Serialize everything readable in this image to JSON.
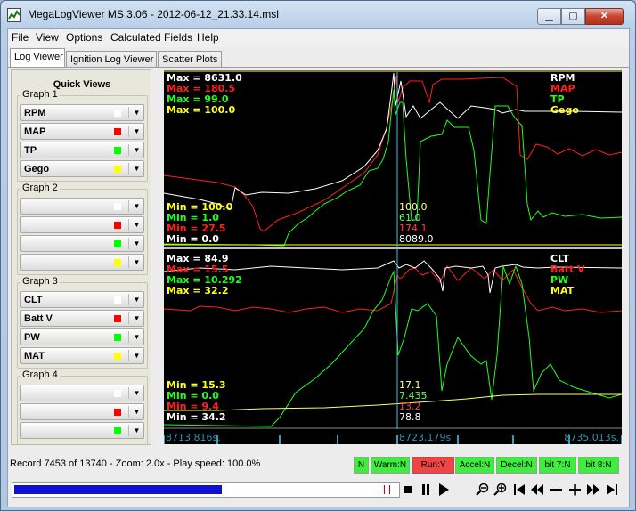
{
  "window": {
    "title": "MegaLogViewer MS 3.06 - 2012-06-12_21.33.14.msl"
  },
  "menu": [
    "File",
    "View",
    "Options",
    "Calculated Fields",
    "Help"
  ],
  "tabs": [
    "Log Viewer",
    "Ignition Log Viewer",
    "Scatter Plots"
  ],
  "quick_views": {
    "title": "Quick Views",
    "graphs": [
      {
        "label": "Graph 1",
        "fields": [
          {
            "name": "RPM",
            "color": "#ffffff"
          },
          {
            "name": "MAP",
            "color": "#ff0000"
          },
          {
            "name": "TP",
            "color": "#00ff00"
          },
          {
            "name": "Gego",
            "color": "#ffff00"
          }
        ]
      },
      {
        "label": "Graph 2",
        "fields": [
          {
            "name": "",
            "color": "#ffffff"
          },
          {
            "name": "",
            "color": "#ff0000"
          },
          {
            "name": "",
            "color": "#00ff00"
          },
          {
            "name": "",
            "color": "#ffff00"
          }
        ]
      },
      {
        "label": "Graph 3",
        "fields": [
          {
            "name": "CLT",
            "color": "#ffffff"
          },
          {
            "name": "Batt V",
            "color": "#ff0000"
          },
          {
            "name": "PW",
            "color": "#00ff00"
          },
          {
            "name": "MAT",
            "color": "#ffff00"
          }
        ]
      },
      {
        "label": "Graph 4",
        "fields": [
          {
            "name": "",
            "color": "#ffffff"
          },
          {
            "name": "",
            "color": "#ff0000"
          },
          {
            "name": "",
            "color": "#00ff00"
          }
        ]
      }
    ]
  },
  "graph_panels": [
    {
      "names": [
        {
          "text": "RPM",
          "color": "#ffffff"
        },
        {
          "text": "MAP",
          "color": "#ff2020"
        },
        {
          "text": "TP",
          "color": "#20ff20"
        },
        {
          "text": "Gego",
          "color": "#ffff20"
        }
      ],
      "max_labels": [
        {
          "text": "Max = 8631.0",
          "color": "#ffffff"
        },
        {
          "text": "Max = 180.5",
          "color": "#ff2020"
        },
        {
          "text": "Max = 99.0",
          "color": "#20ff20"
        },
        {
          "text": "Max = 100.0",
          "color": "#ffff20"
        }
      ],
      "min_labels": [
        {
          "text": "Min = 100.0",
          "color": "#ffff20"
        },
        {
          "text": "Min = 1.0",
          "color": "#20ff20"
        },
        {
          "text": "Min = 27.5",
          "color": "#ff2020"
        },
        {
          "text": "Min = 0.0",
          "color": "#ffffff"
        }
      ],
      "cursor_values": [
        {
          "text": "100.0",
          "color": "#ffff80"
        },
        {
          "text": "61.0",
          "color": "#60ff60"
        },
        {
          "text": "174.1",
          "color": "#ff4040"
        },
        {
          "text": "8089.0",
          "color": "#ffffff"
        }
      ]
    },
    {
      "names": [
        {
          "text": "CLT",
          "color": "#ffffff"
        },
        {
          "text": "Batt V",
          "color": "#ff2020"
        },
        {
          "text": "PW",
          "color": "#20ff20"
        },
        {
          "text": "MAT",
          "color": "#ffff20"
        }
      ],
      "max_labels": [
        {
          "text": "Max = 84.9",
          "color": "#ffffff"
        },
        {
          "text": "Max = 15.5",
          "color": "#ff2020"
        },
        {
          "text": "Max = 10.292",
          "color": "#20ff20"
        },
        {
          "text": "Max = 32.2",
          "color": "#ffff20"
        }
      ],
      "min_labels": [
        {
          "text": "Min = 15.3",
          "color": "#ffff20"
        },
        {
          "text": "Min = 0.0",
          "color": "#20ff20"
        },
        {
          "text": "Min = 9.4",
          "color": "#ff2020"
        },
        {
          "text": "Min = 34.2",
          "color": "#ffffff"
        }
      ],
      "cursor_values": [
        {
          "text": "17.1",
          "color": "#ffff80"
        },
        {
          "text": "7.435",
          "color": "#60ff60"
        },
        {
          "text": "13.2",
          "color": "#ff4040"
        },
        {
          "text": "78.8",
          "color": "#ffffff"
        }
      ]
    }
  ],
  "timeline": {
    "left": "8713.816s.",
    "cursor": "8723.179s",
    "right": "8735.013s."
  },
  "status": {
    "record_text": "Record 7453 of 13740 - Zoom: 2.0x - Play speed: 100.0%",
    "indicators": [
      {
        "text": "N",
        "state": "off"
      },
      {
        "text": "Warm:N",
        "state": "off"
      },
      {
        "text": "Run:Y",
        "state": "on"
      },
      {
        "text": "Accel:N",
        "state": "off"
      },
      {
        "text": "Decel:N",
        "state": "off"
      },
      {
        "text": "bit 7:N",
        "state": "off"
      },
      {
        "text": "bit 8:N",
        "state": "off"
      }
    ]
  },
  "playback": {
    "progress": 0.54
  }
}
